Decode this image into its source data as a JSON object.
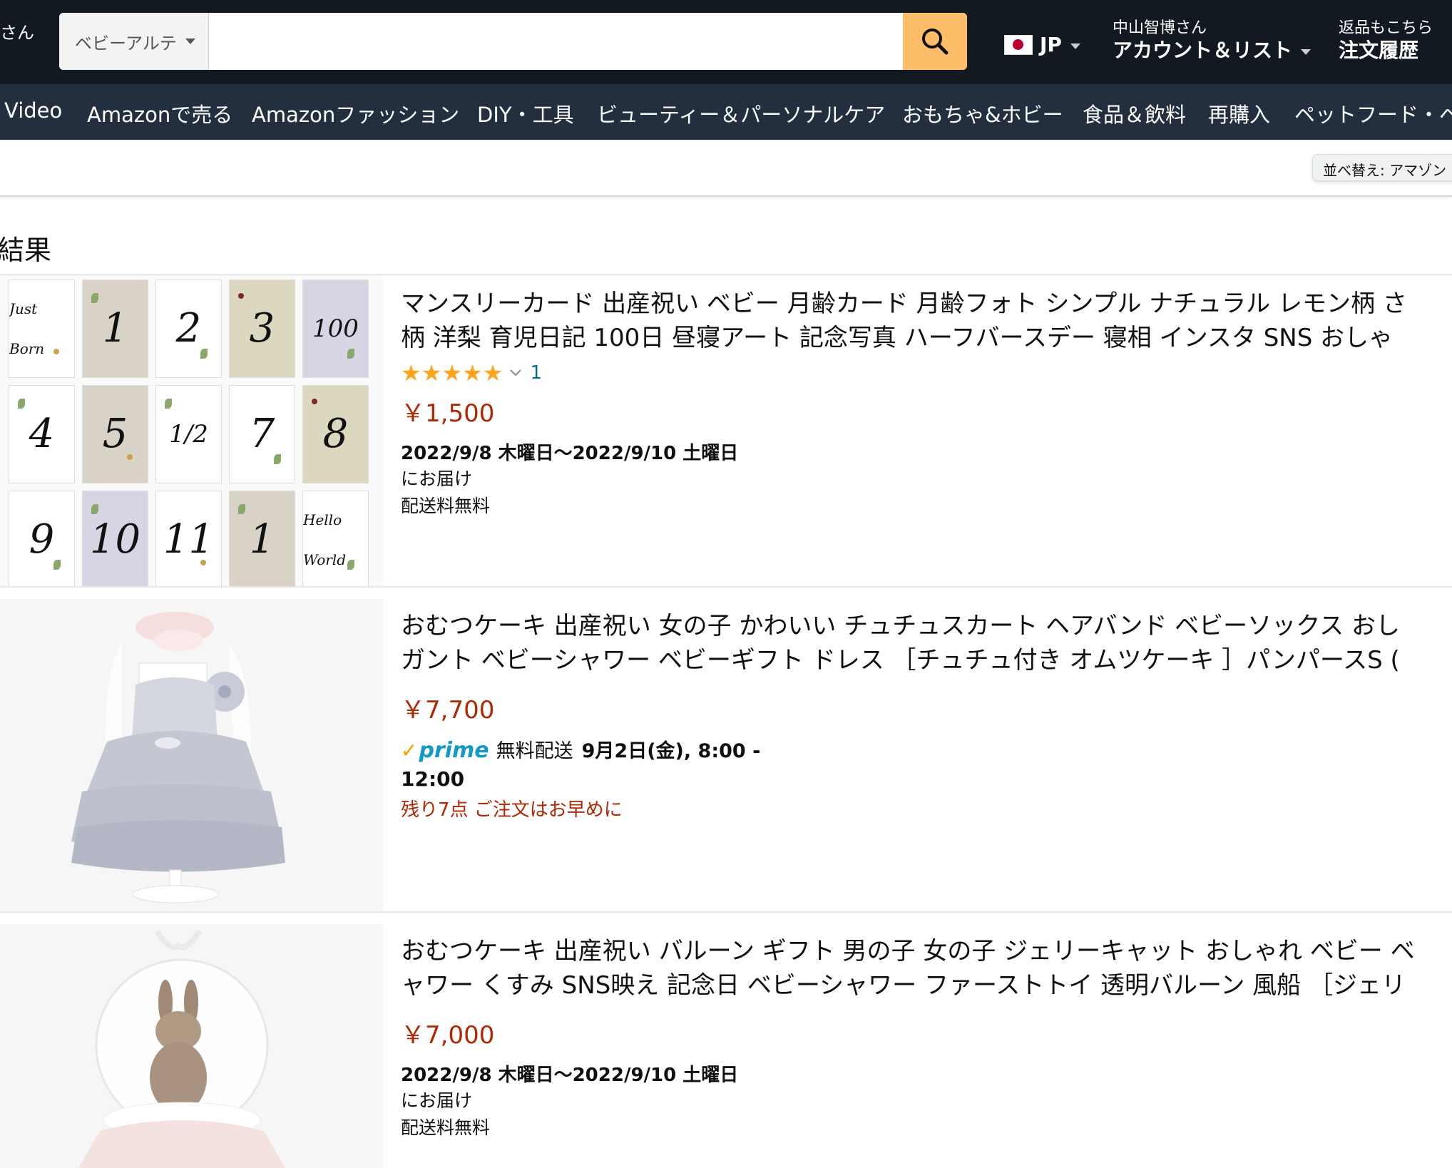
{
  "header": {
    "partial_left": "さん",
    "search_category": "ベビーアルテ",
    "search_value": "",
    "lang": "JP",
    "account_greeting": "中山智博さん",
    "account_label": "アカウント＆リスト",
    "returns_label": "返品もこちら",
    "orders_label": "注文履歴"
  },
  "nav": {
    "items": [
      "Video",
      "Amazonで売る",
      "Amazonファッション",
      "DIY・工具",
      "ビューティー＆パーソナルケア",
      "おもちゃ&ホビー",
      "食品＆飲料",
      "再購入",
      "ペットフード・ペ"
    ]
  },
  "sort": {
    "label": "並べ替え: アマゾン"
  },
  "results_heading": "結果",
  "products": [
    {
      "title_line1": "マンスリーカード 出産祝い ベビー 月齢カード 月齢フォト シンプル ナチュラル レモン柄 さ",
      "title_line2": "柄 洋梨 育児日記 100日 昼寝アート 記念写真 ハーフバースデー 寝相 インスタ SNS おしゃ",
      "rating_count": "1",
      "price": "￥1,500",
      "delivery_date": "2022/9/8 木曜日〜2022/9/10 土曜日",
      "delivery_note": "にお届け",
      "shipping": "配送料無料",
      "cards": [
        {
          "text": "Just Born",
          "bg": "#ffffff"
        },
        {
          "text": "1",
          "bg": "#d9d2c6"
        },
        {
          "text": "2",
          "bg": "#ffffff"
        },
        {
          "text": "3",
          "bg": "#dcd7bf"
        },
        {
          "text": "100",
          "bg": "#d8d4e4"
        },
        {
          "text": "4",
          "bg": "#ffffff"
        },
        {
          "text": "5",
          "bg": "#d9d2c6"
        },
        {
          "text": "1/2",
          "bg": "#ffffff"
        },
        {
          "text": "7",
          "bg": "#ffffff"
        },
        {
          "text": "8",
          "bg": "#dcd7bf"
        },
        {
          "text": "9",
          "bg": "#ffffff"
        },
        {
          "text": "10",
          "bg": "#d8d4e4"
        },
        {
          "text": "11",
          "bg": "#ffffff"
        },
        {
          "text": "1",
          "bg": "#d9d2c6"
        },
        {
          "text": "Hello World",
          "bg": "#ffffff"
        }
      ]
    },
    {
      "title_line1": "おむつケーキ 出産祝い 女の子 かわいい チュチュスカート ヘアバンド ベビーソックス おし",
      "title_line2": "ガント ベビーシャワー ベビーギフト ドレス ［チュチュ付き オムツケーキ ］パンパースS (",
      "price": "￥7,700",
      "prime_label": "prime",
      "prime_shipping": "無料配送",
      "prime_date_part1": "9月2日(金), 8:00 -",
      "prime_date_part2": "12:00",
      "stock": "残り7点 ご注文はお早めに"
    },
    {
      "title_line1": "おむつケーキ 出産祝い バルーン ギフト 男の子 女の子 ジェリーキャット おしゃれ ベビー ベ",
      "title_line2": "ャワー くすみ SNS映え 記念日 ベビーシャワー ファーストトイ 透明バルーン 風船 ［ジェリ",
      "price": "￥7,000",
      "delivery_date": "2022/9/8 木曜日〜2022/9/10 土曜日",
      "delivery_note": "にお届け",
      "shipping": "配送料無料"
    }
  ],
  "colors": {
    "header_bg": "#131921",
    "nav_bg": "#232f3e",
    "search_button": "#febd69",
    "price": "#b12704",
    "star": "#ffa41c",
    "link": "#007185"
  }
}
